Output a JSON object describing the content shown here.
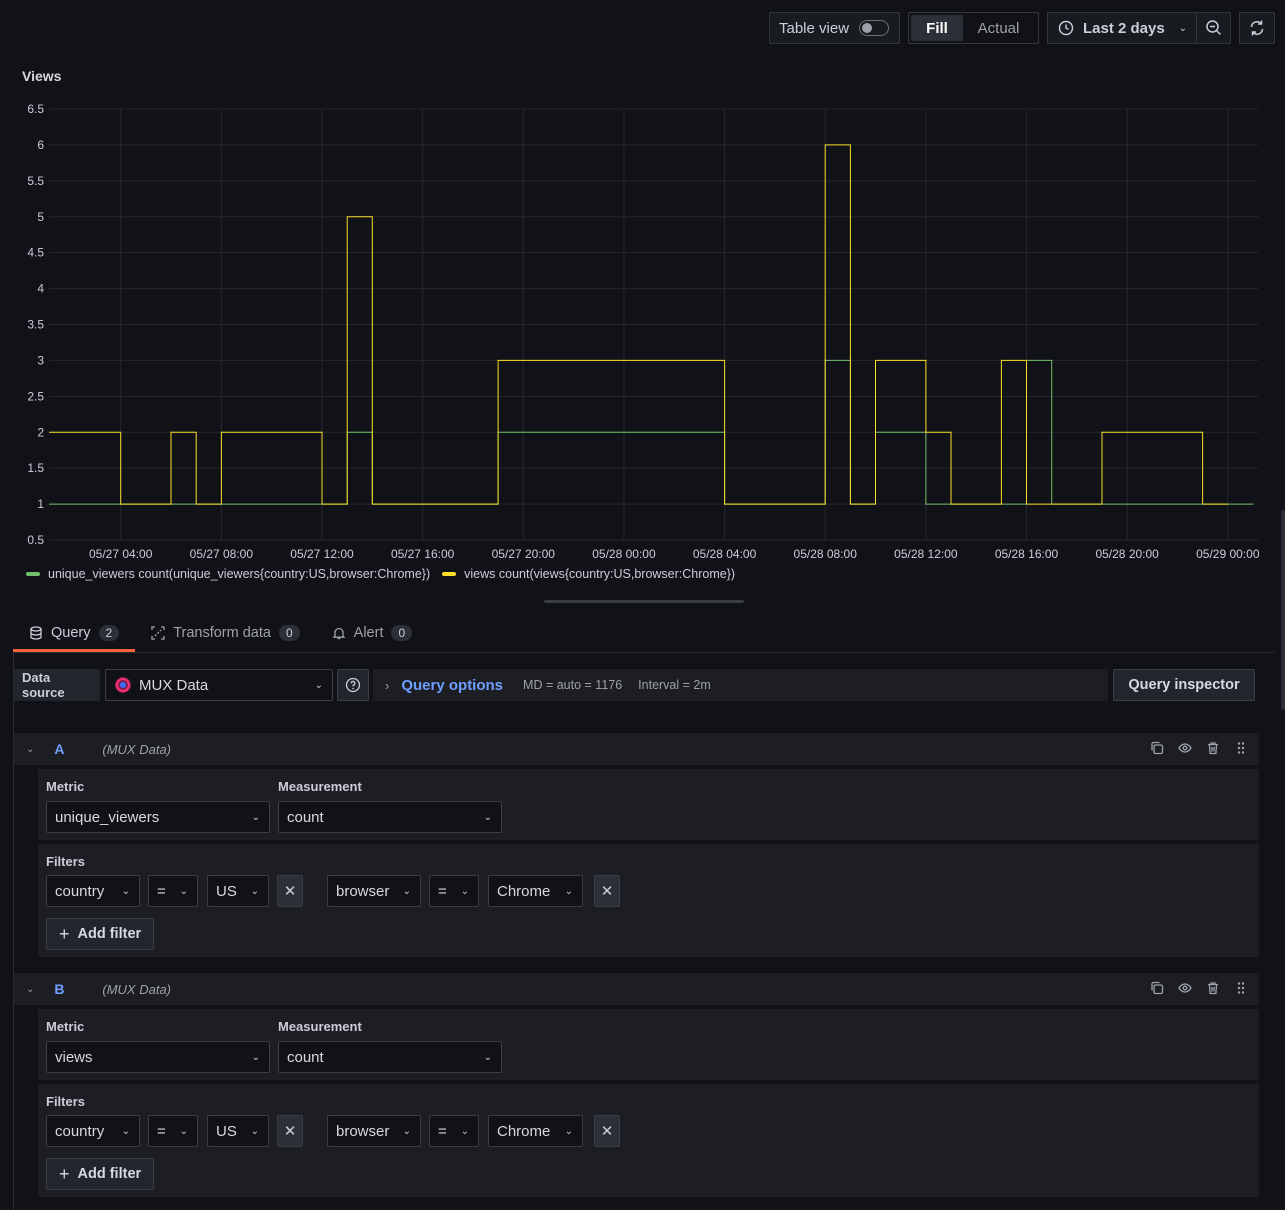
{
  "toolbar": {
    "table_view_label": "Table view",
    "fill_label": "Fill",
    "actual_label": "Actual",
    "time_range_label": "Last 2 days"
  },
  "panel": {
    "title": "Views"
  },
  "chart_data": {
    "type": "line",
    "title": "Views",
    "step": true,
    "y_ticks": [
      "0.5",
      "1",
      "1.5",
      "2",
      "2.5",
      "3",
      "3.5",
      "4",
      "4.5",
      "5",
      "5.5",
      "6",
      "6.5"
    ],
    "ylim": [
      0.5,
      6.5
    ],
    "x_ticks": [
      "05/27 04:00",
      "05/27 08:00",
      "05/27 12:00",
      "05/27 16:00",
      "05/27 20:00",
      "05/28 00:00",
      "05/28 04:00",
      "05/28 08:00",
      "05/28 12:00",
      "05/28 16:00",
      "05/28 20:00",
      "05/29 00:00"
    ],
    "x_tick_hours": [
      4,
      8,
      12,
      16,
      20,
      24,
      28,
      32,
      36,
      40,
      44,
      48
    ],
    "xlim": [
      1.15,
      49.2
    ],
    "grid": true,
    "legend_position": "bottom-left",
    "series": [
      {
        "name": "unique_viewers count(unique_viewers{country:US,browser:Chrome})",
        "color": "#73bf69",
        "points": [
          [
            1.15,
            1
          ],
          [
            13,
            1
          ],
          [
            13,
            2
          ],
          [
            14,
            2
          ],
          [
            14,
            1
          ],
          [
            19,
            1
          ],
          [
            19,
            2
          ],
          [
            28,
            2
          ],
          [
            28,
            1
          ],
          [
            32,
            1
          ],
          [
            32,
            3
          ],
          [
            33,
            3
          ],
          [
            33,
            1
          ],
          [
            34,
            1
          ],
          [
            34,
            2
          ],
          [
            36,
            2
          ],
          [
            36,
            1
          ],
          [
            40,
            1
          ],
          [
            40,
            3
          ],
          [
            41,
            3
          ],
          [
            41,
            1
          ],
          [
            49,
            1
          ]
        ]
      },
      {
        "name": "views count(views{country:US,browser:Chrome})",
        "color": "#fade2a",
        "points": [
          [
            1.15,
            2
          ],
          [
            4,
            2
          ],
          [
            4,
            1
          ],
          [
            6,
            1
          ],
          [
            6,
            2
          ],
          [
            7,
            2
          ],
          [
            7,
            1
          ],
          [
            8,
            1
          ],
          [
            8,
            2
          ],
          [
            12,
            2
          ],
          [
            12,
            1
          ],
          [
            13,
            1
          ],
          [
            13,
            5
          ],
          [
            14,
            5
          ],
          [
            14,
            1
          ],
          [
            19,
            1
          ],
          [
            19,
            3
          ],
          [
            28,
            3
          ],
          [
            28,
            1
          ],
          [
            32,
            1
          ],
          [
            32,
            6
          ],
          [
            33,
            6
          ],
          [
            33,
            1
          ],
          [
            34,
            1
          ],
          [
            34,
            3
          ],
          [
            36,
            3
          ],
          [
            36,
            2
          ],
          [
            37,
            2
          ],
          [
            37,
            1
          ],
          [
            39,
            1
          ],
          [
            39,
            3
          ],
          [
            40,
            3
          ],
          [
            40,
            1
          ],
          [
            43,
            1
          ],
          [
            43,
            2
          ],
          [
            47,
            2
          ],
          [
            47,
            1
          ],
          [
            48,
            1
          ]
        ]
      }
    ]
  },
  "tabs": [
    {
      "label": "Query",
      "count": "2"
    },
    {
      "label": "Transform data",
      "count": "0"
    },
    {
      "label": "Alert",
      "count": "0"
    }
  ],
  "datasource": {
    "label": "Data source",
    "value": "MUX Data",
    "query_options_label": "Query options",
    "md_text": "MD = auto = 1176",
    "interval_text": "Interval = 2m",
    "query_inspector_label": "Query inspector"
  },
  "queries": [
    {
      "ref": "A",
      "ds": "(MUX Data)",
      "metric_label": "Metric",
      "metric": "unique_viewers",
      "measurement_label": "Measurement",
      "measurement": "count",
      "filters_label": "Filters",
      "filters": [
        {
          "key": "country",
          "op": "=",
          "value": "US"
        },
        {
          "key": "browser",
          "op": "=",
          "value": "Chrome"
        }
      ],
      "add_filter_label": "Add filter"
    },
    {
      "ref": "B",
      "ds": "(MUX Data)",
      "metric_label": "Metric",
      "metric": "views",
      "measurement_label": "Measurement",
      "measurement": "count",
      "filters_label": "Filters",
      "filters": [
        {
          "key": "country",
          "op": "=",
          "value": "US"
        },
        {
          "key": "browser",
          "op": "=",
          "value": "Chrome"
        }
      ],
      "add_filter_label": "Add filter"
    }
  ]
}
